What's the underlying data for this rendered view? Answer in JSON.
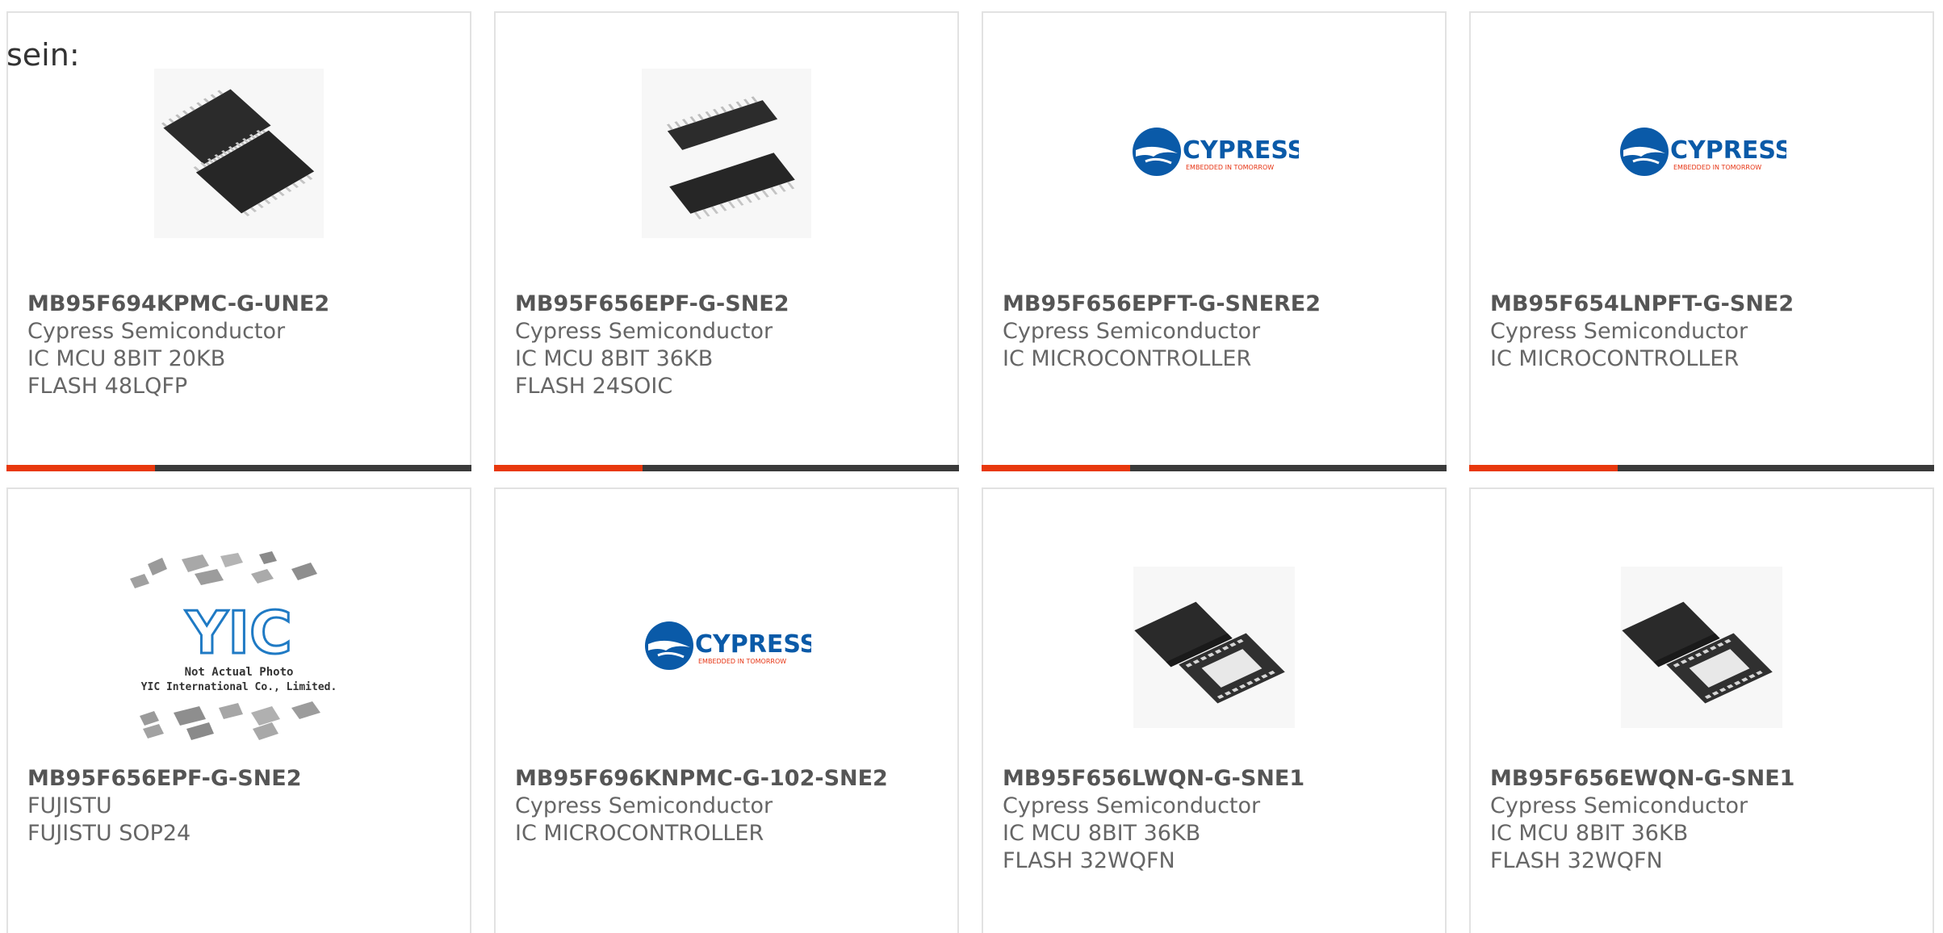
{
  "intro_text": "sein:",
  "colors": {
    "accent_bar": "#e8380d",
    "dark_bar": "#3a3a3a",
    "card_border": "#e2e2e2",
    "cypress_blue": "#0a5aa8",
    "cypress_red": "#e63312"
  },
  "logos": {
    "cypress_name": "CYPRESS",
    "cypress_tagline": "EMBEDDED IN TOMORROW",
    "yic_mark": "YIC",
    "yic_line1": "Not Actual Photo",
    "yic_line2": "YIC International Co., Limited."
  },
  "products": [
    {
      "part": "MB95F694KPMC-G-UNE2",
      "maker": "Cypress Semiconductor",
      "desc": "IC MCU 8BIT 20KB FLASH 48LQFP",
      "image": "qfp-chip-photo"
    },
    {
      "part": "MB95F656EPF-G-SNE2",
      "maker": "Cypress Semiconductor",
      "desc": "IC MCU 8BIT 36KB FLASH 24SOIC",
      "image": "soic-chip-photo"
    },
    {
      "part": "MB95F656EPFT-G-SNERE2",
      "maker": "Cypress Semiconductor",
      "desc": "IC MICROCONTROLLER",
      "image": "cypress-logo"
    },
    {
      "part": "MB95F654LNPFT-G-SNE2",
      "maker": "Cypress Semiconductor",
      "desc": "IC MICROCONTROLLER",
      "image": "cypress-logo"
    },
    {
      "part": "MB95F656EPF-G-SNE2",
      "maker": "FUJISTU",
      "desc": "FUJISTU SOP24",
      "image": "yic-placeholder"
    },
    {
      "part": "MB95F696KNPMC-G-102-SNE2",
      "maker": "Cypress Semiconductor",
      "desc": "IC MICROCONTROLLER",
      "image": "cypress-logo"
    },
    {
      "part": "MB95F656LWQN-G-SNE1",
      "maker": "Cypress Semiconductor",
      "desc": "IC MCU 8BIT 36KB FLASH 32WQFN",
      "image": "qfn-chip-photo"
    },
    {
      "part": "MB95F656EWQN-G-SNE1",
      "maker": "Cypress Semiconductor",
      "desc": "IC MCU 8BIT 36KB FLASH 32WQFN",
      "image": "qfn-chip-photo"
    }
  ]
}
